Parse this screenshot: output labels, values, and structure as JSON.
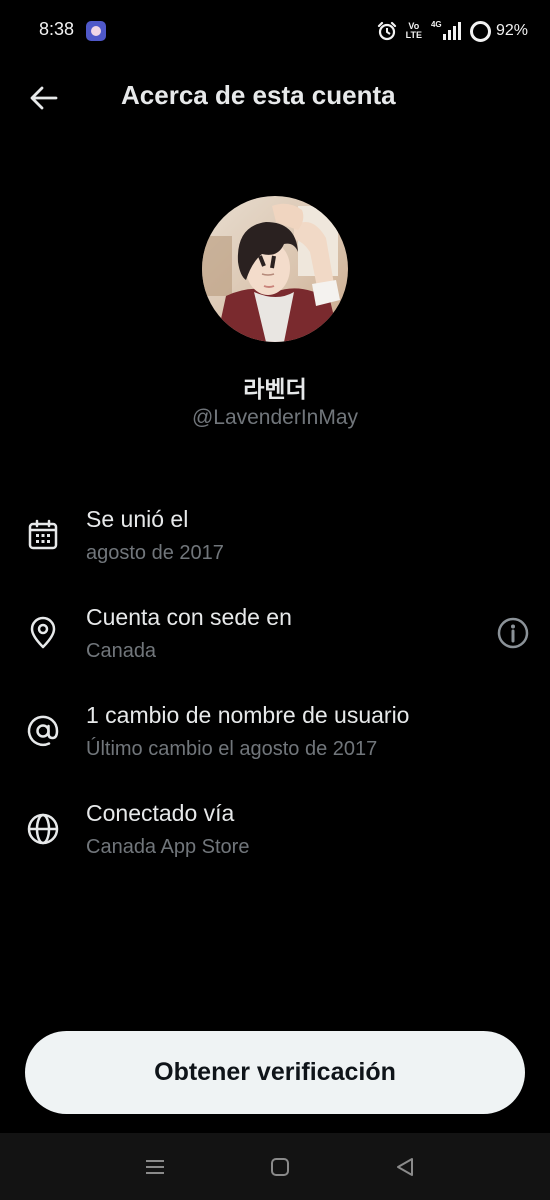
{
  "status_bar": {
    "time": "8:38",
    "volte_top": "Vo",
    "volte_bottom": "LTE",
    "network": "4G",
    "battery": "92%"
  },
  "header": {
    "title": "Acerca de esta cuenta",
    "back_icon": "arrow-left-icon"
  },
  "profile": {
    "display_name": "라벤더",
    "handle": "@LavenderInMay"
  },
  "info": {
    "joined": {
      "icon": "calendar-icon",
      "title": "Se unió el",
      "value": "agosto de 2017"
    },
    "location": {
      "icon": "location-pin-icon",
      "title": "Cuenta con sede en",
      "value": "Canada",
      "help_icon": "info-circle-icon"
    },
    "username_changes": {
      "icon": "at-sign-icon",
      "title": "1 cambio de nombre de usuario",
      "value": "Último cambio el agosto de 2017"
    },
    "connected": {
      "icon": "globe-icon",
      "title": "Conectado vía",
      "value": "Canada App Store"
    }
  },
  "cta": {
    "label": "Obtener verificación"
  },
  "nav_bar": {
    "icons": [
      "menu-icon",
      "home-square-icon",
      "back-triangle-icon"
    ]
  },
  "colors": {
    "background": "#000000",
    "primary_text": "#e7e9ea",
    "secondary_text": "#71767b",
    "button_bg": "#eff3f4",
    "button_text": "#0f1419",
    "nav_bar_bg": "#131313"
  }
}
